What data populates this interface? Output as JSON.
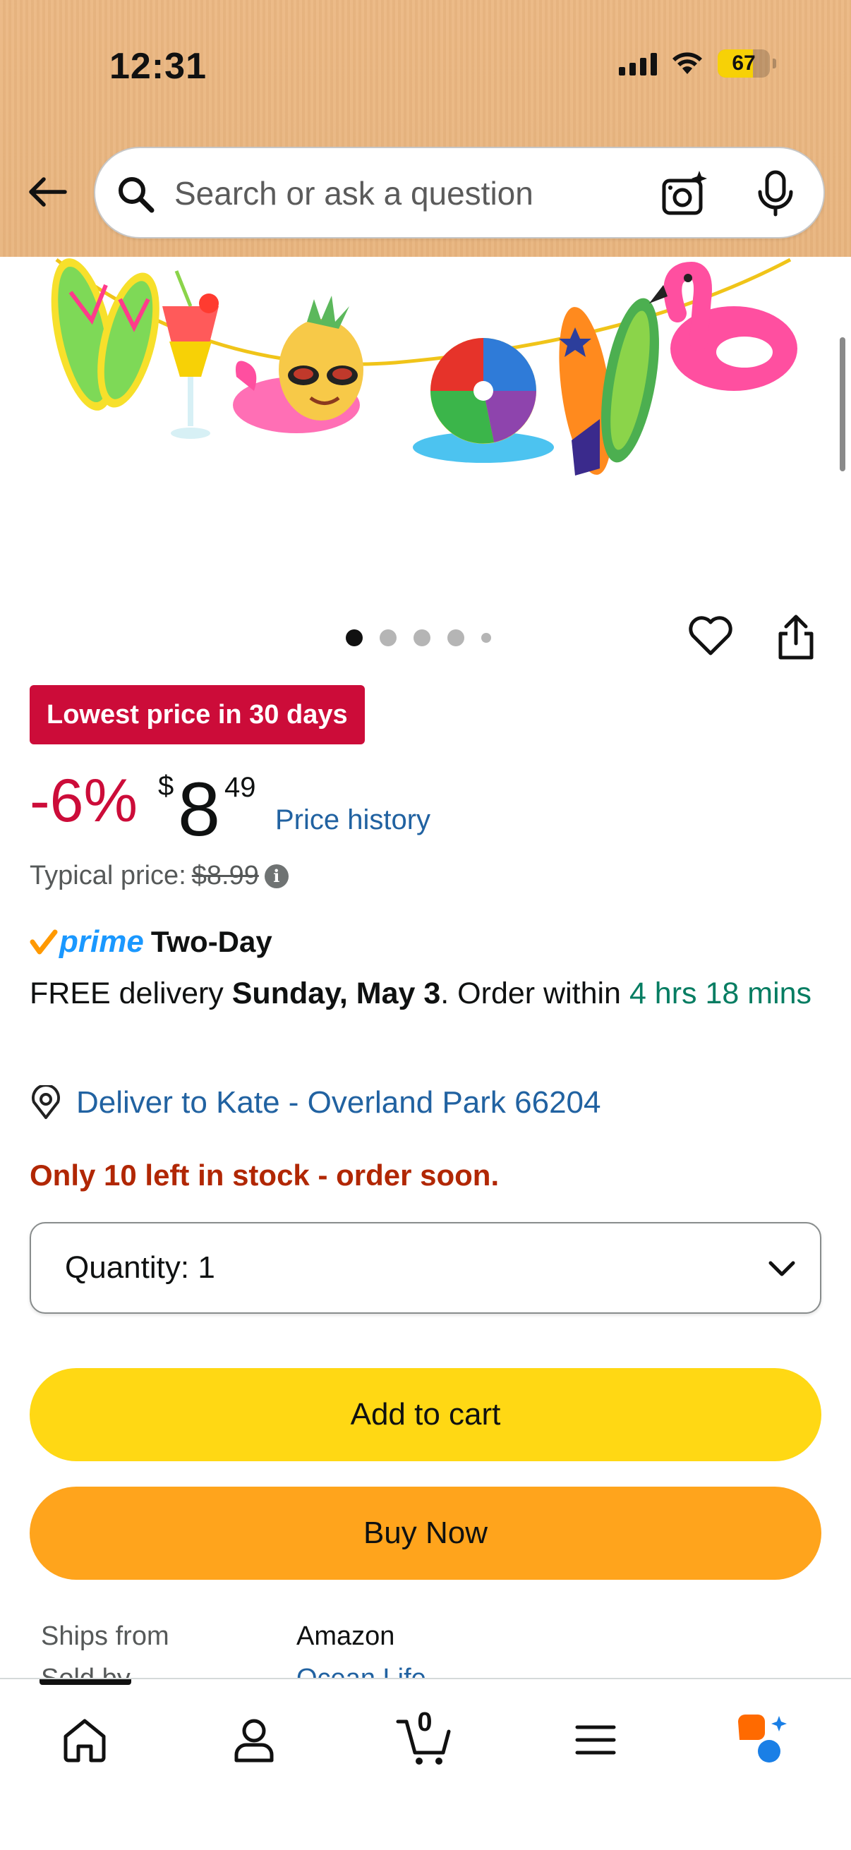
{
  "status_bar": {
    "time": "12:31",
    "battery": "67",
    "battery_level": 0.67
  },
  "search": {
    "placeholder": "Search or ask a question"
  },
  "carousel": {
    "total_images": 5,
    "active_index": 0
  },
  "price_block": {
    "deal_badge": "Lowest price in 30 days",
    "discount": "-6%",
    "currency": "$",
    "price_whole": "8",
    "price_fraction": "49",
    "price_history_link": "Price history",
    "typical_label": "Typical price:",
    "typical_value": "$8.99",
    "info_glyph": "i"
  },
  "delivery": {
    "prime_label": "prime",
    "prime_speed": "Two-Day",
    "free_delivery": "FREE delivery",
    "date": "Sunday, May 3",
    "order_within": ". Order within",
    "countdown": "4 hrs 18 mins",
    "deliver_to": "Deliver to Kate - Overland Park 66204"
  },
  "stock": {
    "message": "Only 10 left in stock - order soon."
  },
  "quantity": {
    "label": "Quantity:",
    "value": "1"
  },
  "buttons": {
    "add_to_cart": "Add to cart",
    "buy_now": "Buy Now"
  },
  "details": {
    "ships_from_label": "Ships from",
    "ships_from_value": "Amazon",
    "sold_by_label": "Sold by",
    "sold_by_value": "Ocean Life"
  },
  "bottom_nav": {
    "cart_count": "0",
    "items": [
      "home-icon",
      "account-icon",
      "cart-icon",
      "menu-icon",
      "rufus-icon"
    ]
  },
  "colors": {
    "header_bg": "#eab680",
    "deal_red": "#cc0c39",
    "link_blue": "#2162a1",
    "prime_blue": "#1a98ff",
    "delivery_green": "#067d62",
    "stock_red": "#b12704",
    "cart_yellow": "#ffd814",
    "buy_orange": "#ffa41c"
  }
}
